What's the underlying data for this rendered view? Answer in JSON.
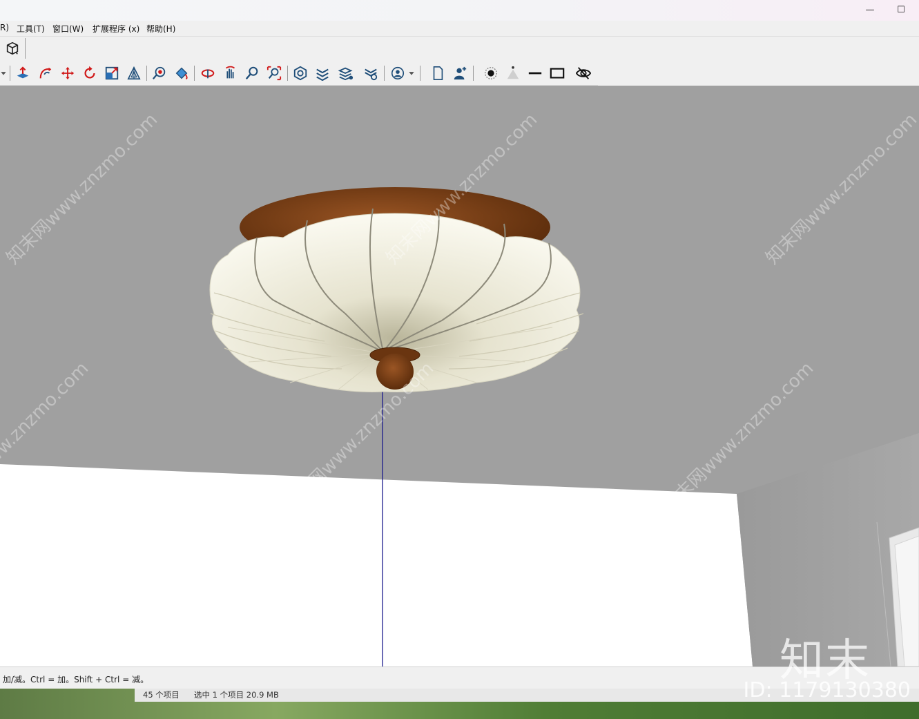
{
  "window": {
    "minimize_label": "—",
    "maximize_label": "☐"
  },
  "menu": {
    "partial": "R)",
    "tools": "工具(T)",
    "window": "窗口(W)",
    "extensions": "扩展程序 (x)",
    "help": "帮助(H)"
  },
  "toolbar1": {
    "items": [
      {
        "icon": "component-box-icon"
      }
    ]
  },
  "toolbar2": {
    "items": [
      {
        "icon": "push-pull-icon",
        "color": "#d01818"
      },
      {
        "icon": "follow-me-icon",
        "color": "#d01818"
      },
      {
        "icon": "move-icon",
        "color": "#d01818"
      },
      {
        "icon": "rotate-icon",
        "color": "#d01818"
      },
      {
        "icon": "scale-icon",
        "color": "#d01818"
      },
      {
        "icon": "offset-icon",
        "color": "#1f4e79"
      },
      {
        "icon": "tape-measure-icon",
        "color": "#d01818"
      },
      {
        "icon": "paint-bucket-icon",
        "color": "#1f4e79"
      },
      {
        "icon": "orbit-icon",
        "color": "#d01818"
      },
      {
        "icon": "pan-icon",
        "color": "#d01818"
      },
      {
        "icon": "zoom-icon",
        "color": "#1f4e79"
      },
      {
        "icon": "zoom-extents-icon",
        "color": "#d01818"
      },
      {
        "icon": "outliner-icon",
        "color": "#1f4e79"
      },
      {
        "icon": "layers-icon",
        "color": "#1f4e79"
      },
      {
        "icon": "tags-icon",
        "color": "#1f4e79"
      },
      {
        "icon": "tag-settings-icon",
        "color": "#1f4e79"
      },
      {
        "icon": "user-account-icon",
        "color": "#1f4e79"
      },
      {
        "icon": "new-file-icon",
        "color": "#1f4e79"
      },
      {
        "icon": "person-add-icon",
        "color": "#1f4e79"
      },
      {
        "icon": "point-light-icon",
        "color": "#222222"
      },
      {
        "icon": "spot-light-icon",
        "color": "#bbbbbb"
      },
      {
        "icon": "line-light-icon",
        "color": "#111111"
      },
      {
        "icon": "rect-light-icon",
        "color": "#111111"
      },
      {
        "icon": "hide-icon",
        "color": "#111111"
      }
    ]
  },
  "status": {
    "hint": "加/减。Ctrl = 加。Shift + Ctrl = 减。",
    "item_count": "45 个项目",
    "selection": "选中 1 个项目  20.9 MB"
  },
  "watermark": {
    "text": "知末网www.znzmo.com",
    "logo": "知末",
    "id": "ID: 1179130380"
  },
  "colors": {
    "wood": "#7a3e12",
    "shade": "#f1efe0",
    "ceiling": "#a0a0a0",
    "wall": "#ffffff",
    "axis_line": "#1a1a8c"
  }
}
